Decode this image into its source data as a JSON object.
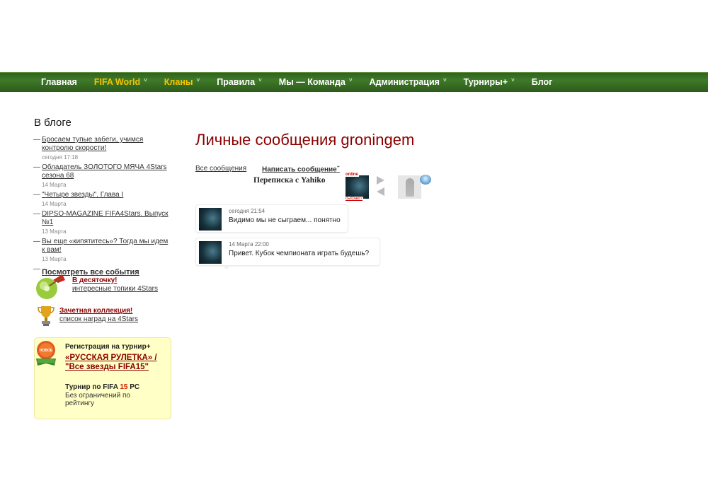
{
  "nav": {
    "items": [
      {
        "label": "Главная",
        "color": "#ffffff",
        "chevron": ""
      },
      {
        "label": "FIFA World",
        "color": "#f5c400",
        "chevron": "˅"
      },
      {
        "label": "Кланы",
        "color": "#f5c400",
        "chevron": "˅"
      },
      {
        "label": "Правила",
        "color": "#ffffff",
        "chevron": "˅"
      },
      {
        "label": "Мы — Команда",
        "color": "#ffffff",
        "chevron": "˅"
      },
      {
        "label": "Администрация",
        "color": "#ffffff",
        "chevron": "˅"
      },
      {
        "label": "Турниры+",
        "color": "#ffffff",
        "chevron": "˅"
      },
      {
        "label": "Блог",
        "color": "#ffffff",
        "chevron": ""
      }
    ]
  },
  "sidebar": {
    "title": "В блоге",
    "posts": [
      {
        "title": "Бросаем тупые забеги, учимся контролю скорости!",
        "date": "сегодня 17:18"
      },
      {
        "title": "Обладатель ЗОЛОТОГО МЯЧА 4Stars сезона 68",
        "date": "14 Марта"
      },
      {
        "title": "\"Четыре звезды\". Глава I",
        "date": "14 Марта"
      },
      {
        "title": "DIPSO-MAGAZINE FIFA4Stars. Выпуск №1",
        "date": "13 Марта"
      },
      {
        "title": "Вы еще «кипятитесь»? Тогда мы идем к вам!",
        "date": "13 Марта"
      }
    ],
    "all_events": "Посмотреть все события",
    "promo1": {
      "title": "В десяточку!",
      "subtitle": "интересные топики 4Stars",
      "icon": "apple-target-icon"
    },
    "promo2": {
      "title": "Зачетная коллекция!",
      "subtitle": "список наград на 4Stars",
      "icon": "trophy-icon"
    },
    "registration": {
      "badge": "НОВОЕ",
      "heading": "Регистрация на турнир+",
      "tournament": "«РУССКАЯ РУЛЕТКА» / \"Все звезды FIFA15\"",
      "line1_prefix": "Турнир по FIFA",
      "line1_num": "15",
      "line1_suffix": "PC",
      "line2": "Без ограничений по рейтингу"
    }
  },
  "main": {
    "title": "Личные сообщения groningem",
    "tab_all": "Все сообщения",
    "tab_write": "Написать сообщение",
    "tab_write_sup": "+",
    "conversation_label": "Переписка с Yahiko",
    "avatar_tag_online": "online",
    "avatar_tag_play": "сыграю?",
    "messages": [
      {
        "date": "сегодня 21:54",
        "text": "Видимо мы не сыграем... понятно"
      },
      {
        "date": "14 Марта 22:00",
        "text": "Привет. Кубок чемпионата играть будешь?"
      }
    ]
  },
  "colors": {
    "accent": "#8b0000",
    "nav_bg": "#3a6e25",
    "nav_highlight": "#f5c400",
    "registration_bg": "#ffffc6"
  }
}
